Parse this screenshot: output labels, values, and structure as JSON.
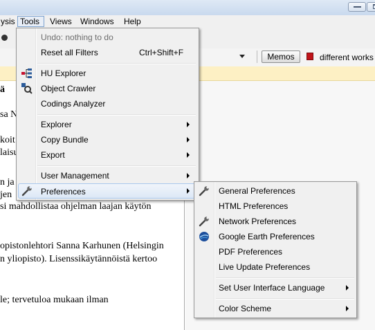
{
  "menubar": {
    "items": [
      "ysis",
      "Tools",
      "Views",
      "Windows",
      "Help"
    ]
  },
  "toolbar": {
    "memos_label": "Memos",
    "document_name": "different works"
  },
  "document": {
    "lines": [
      "ä",
      "sa N",
      "koit",
      "laisu",
      "n ja",
      "jen",
      "si mahdollistaa ohjelman laajan käytön",
      "opistonlehtori Sanna Karhunen (Helsingin",
      "n yliopisto). Lisenssikäytännöistä kertoo",
      "le; tervetuloa mukaan ilman"
    ]
  },
  "tools_menu": {
    "items": [
      {
        "label": "Undo: nothing to do",
        "disabled": true
      },
      {
        "label": "Reset all Filters",
        "shortcut": "Ctrl+Shift+F"
      },
      {
        "label": "HU Explorer",
        "icon": "hu-explorer-icon"
      },
      {
        "label": "Object Crawler",
        "icon": "object-crawler-icon"
      },
      {
        "label": "Codings Analyzer"
      },
      {
        "label": "Explorer",
        "submenu": true
      },
      {
        "label": "Copy Bundle",
        "submenu": true
      },
      {
        "label": "Export",
        "submenu": true
      },
      {
        "label": "User Management",
        "submenu": true
      },
      {
        "label": "Preferences",
        "submenu": true,
        "icon": "wrench-icon",
        "highlighted": true
      }
    ]
  },
  "preferences_menu": {
    "items": [
      {
        "label": "General Preferences",
        "icon": "wrench-icon"
      },
      {
        "label": "HTML Preferences"
      },
      {
        "label": "Network Preferences",
        "icon": "wrench-icon"
      },
      {
        "label": "Google Earth Preferences",
        "icon": "globe-icon"
      },
      {
        "label": "PDF Preferences"
      },
      {
        "label": "Live Update Preferences"
      },
      {
        "label": "Set User Interface Language",
        "submenu": true
      },
      {
        "label": "Color Scheme",
        "submenu": true
      }
    ]
  },
  "colors": {
    "highlight_border": "#a8c7ed",
    "band": "#fdf0c4",
    "menu_bg": "#f0f0f0"
  }
}
